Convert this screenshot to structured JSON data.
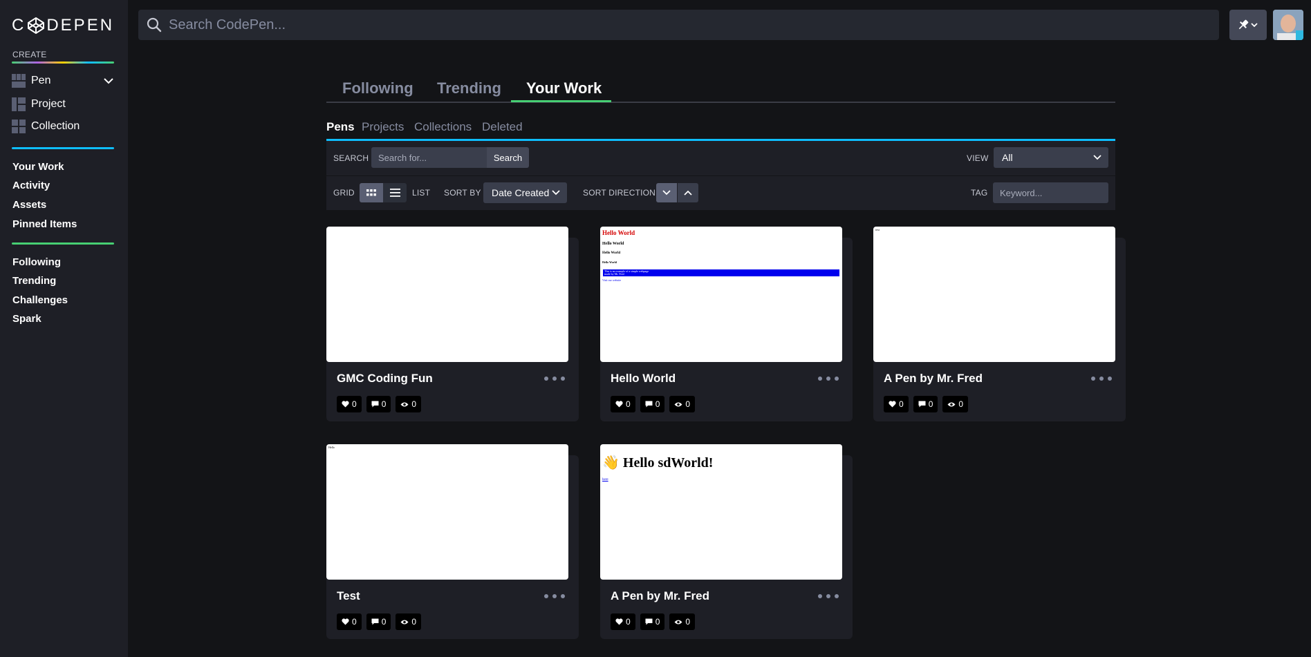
{
  "brand": {
    "logo_text_left": "C",
    "logo_text_right": "DEPEN"
  },
  "sidebar": {
    "create_label": "CREATE",
    "create_items": [
      {
        "label": "Pen"
      },
      {
        "label": "Project"
      },
      {
        "label": "Collection"
      }
    ],
    "nav_group_1": [
      "Your Work",
      "Activity",
      "Assets",
      "Pinned Items"
    ],
    "nav_group_2": [
      "Following",
      "Trending",
      "Challenges",
      "Spark"
    ]
  },
  "topbar": {
    "search_placeholder": "Search CodePen..."
  },
  "main_tabs": [
    "Following",
    "Trending",
    "Your Work"
  ],
  "sub_tabs": [
    "Pens",
    "Projects",
    "Collections",
    "Deleted"
  ],
  "filters": {
    "search_label": "SEARCH",
    "search_placeholder": "Search for...",
    "search_button": "Search",
    "view_label": "VIEW",
    "view_value": "All",
    "grid_label": "GRID",
    "list_label": "LIST",
    "sort_by_label": "SORT BY",
    "sort_by_value": "Date Created",
    "sort_direction_label": "SORT DIRECTION",
    "tag_label": "TAG",
    "tag_placeholder": "Keyword..."
  },
  "pens": [
    {
      "title": "GMC Coding Fun",
      "likes": "0",
      "comments": "0",
      "views": "0"
    },
    {
      "title": "Hello World",
      "likes": "0",
      "comments": "0",
      "views": "0"
    },
    {
      "title": "A Pen by Mr. Fred",
      "likes": "0",
      "comments": "0",
      "views": "0"
    },
    {
      "title": "Test",
      "likes": "0",
      "comments": "0",
      "views": "0"
    },
    {
      "title": "A Pen by Mr. Fred",
      "likes": "0",
      "comments": "0",
      "views": "0"
    }
  ],
  "previews": {
    "hello": {
      "h1": "Hello World",
      "h2": "Hello World",
      "h3": "Hello World",
      "h4": "Hello World",
      "blue_line_1": "This is an example of a simple webpage",
      "blue_line_2": "made by Mr. Fred",
      "link": "Visit our website"
    },
    "pen3_text": "text",
    "test_text": "Hello",
    "wave_heading": "👋 Hello sdWorld!",
    "wave_link": "here"
  },
  "colors": {
    "green": "#47cf73",
    "blue": "#0ebeff",
    "sidebar_bg": "#1e1f26",
    "page_bg": "#131417"
  }
}
